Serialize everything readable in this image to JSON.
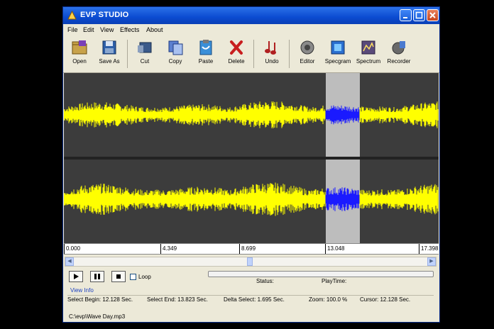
{
  "window": {
    "title": "EVP STUDIO"
  },
  "menu": [
    "File",
    "Edit",
    "View",
    "Effects",
    "About"
  ],
  "toolbar": [
    "Open",
    "Save As",
    "Cut",
    "Copy",
    "Paste",
    "Delete",
    "Undo",
    "Editor",
    "Specgram",
    "Spectrum",
    "Recorder"
  ],
  "ruler": [
    "0.000",
    "4.349",
    "8.699",
    "13.048",
    "17.398"
  ],
  "transport": {
    "loop_label": "Loop"
  },
  "status": {
    "status_label": "Status:",
    "playtime_label": "PlayTime:"
  },
  "view_info": "View Info",
  "info": {
    "select_begin": "Select Begin: 12.128 Sec.",
    "select_end": "Select End: 13.823 Sec.",
    "delta_select": "Delta Select: 1.695 Sec.",
    "zoom": "Zoom: 100.0 %",
    "cursor": "Cursor: 12.128 Sec."
  },
  "file_path": "C:\\evp\\Wave Day.mp3",
  "colors": {
    "waveform": "#ffff00",
    "selected_waveform": "#1a1aff",
    "background": "#3c3c3c",
    "selection": "#bdbdbd"
  }
}
